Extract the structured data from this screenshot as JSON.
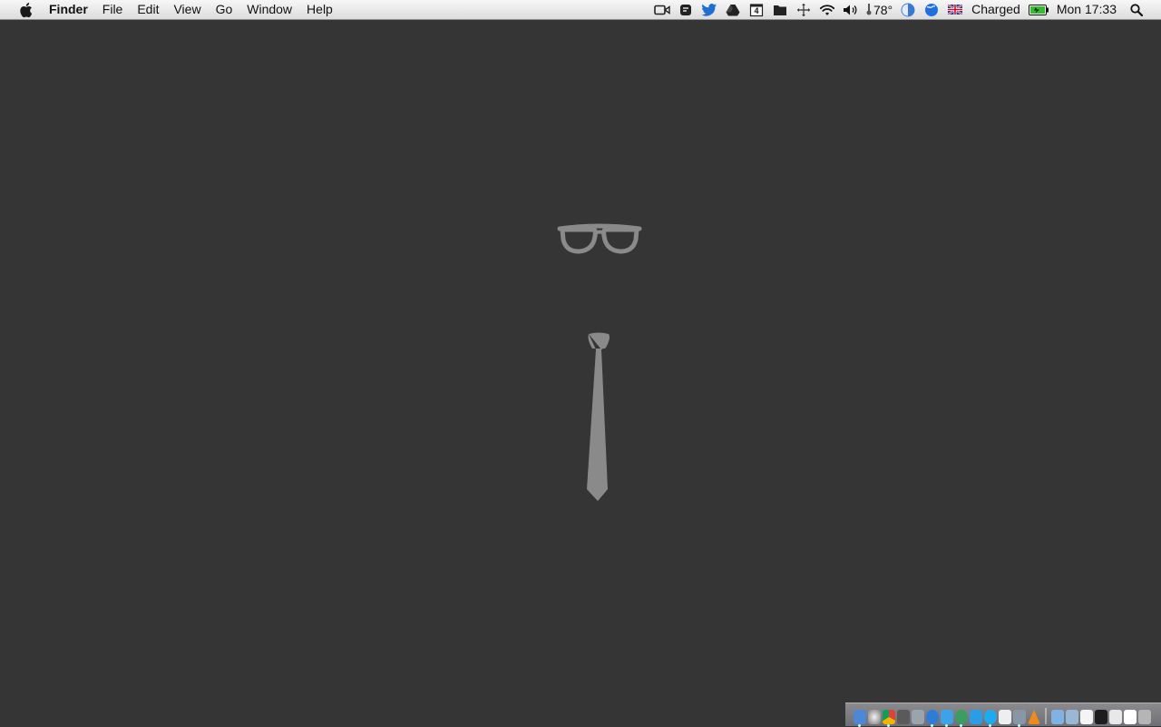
{
  "menubar": {
    "app_name": "Finder",
    "menus": [
      "File",
      "Edit",
      "View",
      "Go",
      "Window",
      "Help"
    ],
    "calendar_day": "4",
    "temperature": "78°",
    "battery_status": "Charged",
    "clock": "Mon 17:33"
  },
  "wallpaper": {
    "background_color": "#353535",
    "art_color": "#8a8a8a",
    "icons": [
      "glasses-icon",
      "necktie-icon"
    ]
  },
  "dock": {
    "icons": [
      "finder-icon",
      "safari-icon",
      "chrome-icon",
      "app-icon",
      "preview-icon",
      "safari-compass-icon",
      "twitter-icon",
      "maps-icon",
      "app-store-icon",
      "skype-icon",
      "textedit-icon",
      "system-prefs-icon",
      "vlc-icon",
      "folder-icon",
      "downloads-icon",
      "document-icon",
      "terminal-icon",
      "window-icon",
      "mail-icon",
      "trash-icon"
    ]
  }
}
